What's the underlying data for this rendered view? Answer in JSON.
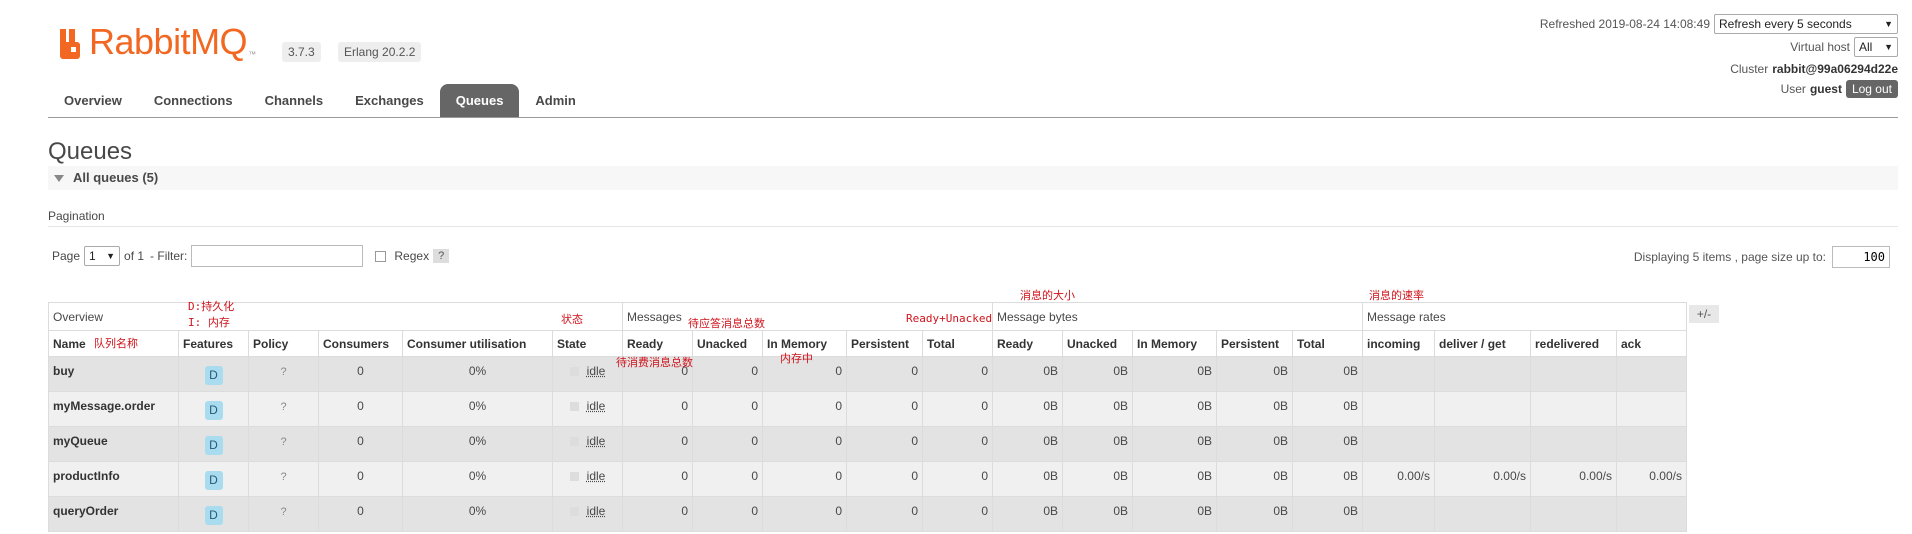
{
  "app": {
    "logo_text": "RabbitMQ",
    "logo_tm": "™",
    "version": "3.7.3",
    "erlang": "Erlang 20.2.2",
    "brand_color": "#f26822"
  },
  "status": {
    "refreshed": "Refreshed 2019-08-24 14:08:49",
    "refresh_option": "Refresh every 5 seconds",
    "vhost_label": "Virtual host",
    "vhost_value": "All",
    "cluster_label": "Cluster",
    "cluster_value": "rabbit@99a06294d22e",
    "user_label": "User",
    "user_value": "guest",
    "logout_label": "Log out"
  },
  "nav": {
    "tabs": [
      {
        "label": "Overview",
        "active": false
      },
      {
        "label": "Connections",
        "active": false
      },
      {
        "label": "Channels",
        "active": false
      },
      {
        "label": "Exchanges",
        "active": false
      },
      {
        "label": "Queues",
        "active": true
      },
      {
        "label": "Admin",
        "active": false
      }
    ]
  },
  "main": {
    "title": "Queues",
    "section_label": "All queues (5)",
    "pagination_label": "Pagination",
    "page_label": "Page",
    "page_value": "1",
    "of_label": "of 1",
    "filter_label": "- Filter:",
    "regex_label": "Regex",
    "help_label": "?",
    "displaying_label": "Displaying 5 items , page size up to:",
    "page_size": "100",
    "plus_minus": "+/-"
  },
  "table": {
    "groups": {
      "overview": "Overview",
      "messages": "Messages",
      "message_bytes": "Message bytes",
      "message_rates": "Message rates"
    },
    "headers": [
      "Name",
      "Features",
      "Policy",
      "Consumers",
      "Consumer utilisation",
      "State",
      "Ready",
      "Unacked",
      "In Memory",
      "Persistent",
      "Total",
      "Ready",
      "Unacked",
      "In Memory",
      "Persistent",
      "Total",
      "incoming",
      "deliver / get",
      "redelivered",
      "ack"
    ],
    "rows": [
      {
        "name": "buy",
        "feature": "D",
        "policy": "?",
        "consumers": "0",
        "util": "0%",
        "state": "idle",
        "msg": [
          "0",
          "0",
          "0",
          "0",
          "0"
        ],
        "bytes": [
          "0B",
          "0B",
          "0B",
          "0B",
          "0B"
        ],
        "rates": [
          "",
          "",
          "",
          ""
        ]
      },
      {
        "name": "myMessage.order",
        "feature": "D",
        "policy": "?",
        "consumers": "0",
        "util": "0%",
        "state": "idle",
        "msg": [
          "0",
          "0",
          "0",
          "0",
          "0"
        ],
        "bytes": [
          "0B",
          "0B",
          "0B",
          "0B",
          "0B"
        ],
        "rates": [
          "",
          "",
          "",
          ""
        ]
      },
      {
        "name": "myQueue",
        "feature": "D",
        "policy": "?",
        "consumers": "0",
        "util": "0%",
        "state": "idle",
        "msg": [
          "0",
          "0",
          "0",
          "0",
          "0"
        ],
        "bytes": [
          "0B",
          "0B",
          "0B",
          "0B",
          "0B"
        ],
        "rates": [
          "",
          "",
          "",
          ""
        ]
      },
      {
        "name": "productInfo",
        "feature": "D",
        "policy": "?",
        "consumers": "0",
        "util": "0%",
        "state": "idle",
        "msg": [
          "0",
          "0",
          "0",
          "0",
          "0"
        ],
        "bytes": [
          "0B",
          "0B",
          "0B",
          "0B",
          "0B"
        ],
        "rates": [
          "0.00/s",
          "0.00/s",
          "0.00/s",
          "0.00/s"
        ]
      },
      {
        "name": "queryOrder",
        "feature": "D",
        "policy": "?",
        "consumers": "0",
        "util": "0%",
        "state": "idle",
        "msg": [
          "0",
          "0",
          "0",
          "0",
          "0"
        ],
        "bytes": [
          "0B",
          "0B",
          "0B",
          "0B",
          "0B"
        ],
        "rates": [
          "",
          "",
          "",
          ""
        ]
      }
    ]
  },
  "annotations": {
    "durable": "D:持久化",
    "memory": "I: 内存",
    "queue_name": "队列名称",
    "state": "状态",
    "unacked_total": "待应答消息总数",
    "ready_unacked": "Ready+Unacked",
    "msg_size": "消息的大小",
    "msg_rate": "消息的速率",
    "ready_total": "待消费消息总数",
    "in_memory": "内存中"
  }
}
